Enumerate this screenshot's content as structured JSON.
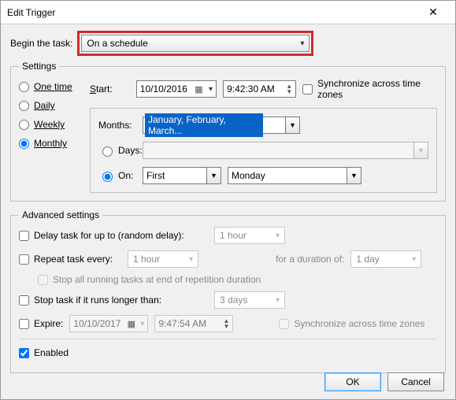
{
  "window": {
    "title": "Edit Trigger"
  },
  "begin": {
    "label": "Begin the task:",
    "value": "On a schedule"
  },
  "settings": {
    "legend": "Settings",
    "radios": {
      "one_time": "One time",
      "daily": "Daily",
      "weekly": "Weekly",
      "monthly": "Monthly"
    },
    "start_label": "Start:",
    "start_date": "10/10/2016",
    "start_time": "9:42:30 AM",
    "sync_tz": "Synchronize across time zones",
    "months_label": "Months:",
    "months_value": "January, February, March...",
    "days_label": "Days:",
    "on_label": "On:",
    "on_ordinal": "First",
    "on_day": "Monday"
  },
  "advanced": {
    "legend": "Advanced settings",
    "delay_label": "Delay task for up to (random delay):",
    "delay_value": "1 hour",
    "repeat_label": "Repeat task every:",
    "repeat_value": "1 hour",
    "duration_label": "for a duration of:",
    "duration_value": "1 day",
    "stop_all_label": "Stop all running tasks at end of repetition duration",
    "stop_if_label": "Stop task if it runs longer than:",
    "stop_if_value": "3 days",
    "expire_label": "Expire:",
    "expire_date": "10/10/2017",
    "expire_time": "9:47:54 AM",
    "expire_sync": "Synchronize across time zones",
    "enabled_label": "Enabled"
  },
  "buttons": {
    "ok": "OK",
    "cancel": "Cancel"
  }
}
